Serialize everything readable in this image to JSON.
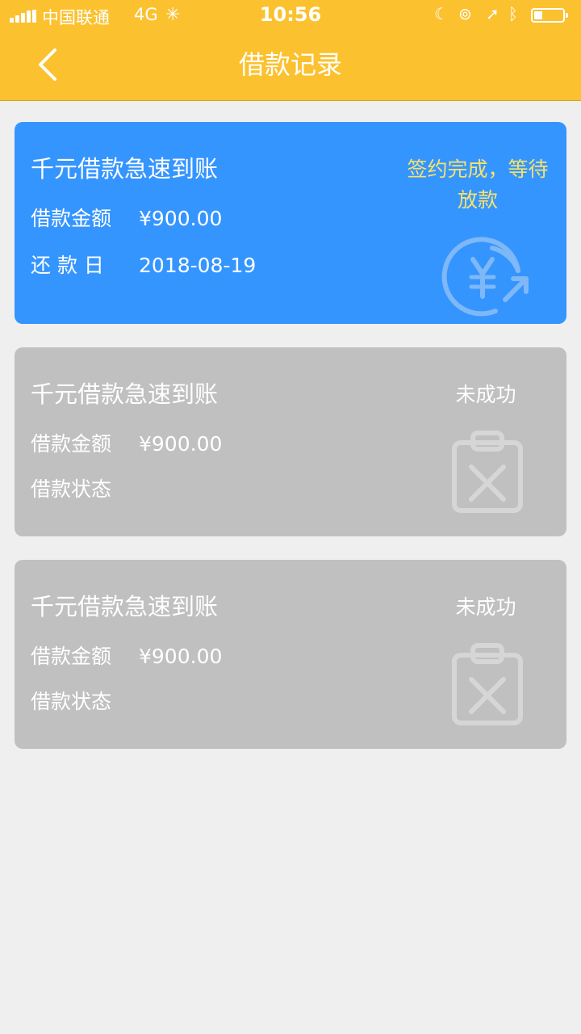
{
  "status_bar": {
    "carrier": "中国联通",
    "network": "4G",
    "time": "10:56"
  },
  "header": {
    "title": "借款记录"
  },
  "cards": [
    {
      "title": "千元借款急速到账",
      "amount_label": "借款金额",
      "amount": "¥900.00",
      "second_label": "还 款 日",
      "second_value": "2018-08-19",
      "status": "签约完成，等待放款",
      "status_color": "#f6e26b",
      "bg_color": "#3595ff",
      "icon": "yuan-refresh-icon"
    },
    {
      "title": "千元借款急速到账",
      "amount_label": "借款金额",
      "amount": "¥900.00",
      "second_label": "借款状态",
      "status": "未成功",
      "bg_color": "#c0c0c0",
      "icon": "clipboard-x-icon"
    },
    {
      "title": "千元借款急速到账",
      "amount_label": "借款金额",
      "amount": "¥900.00",
      "second_label": "借款状态",
      "status": "未成功",
      "bg_color": "#c0c0c0",
      "icon": "clipboard-x-icon"
    }
  ],
  "colors": {
    "header": "#fbc12f",
    "background": "#efefef"
  }
}
